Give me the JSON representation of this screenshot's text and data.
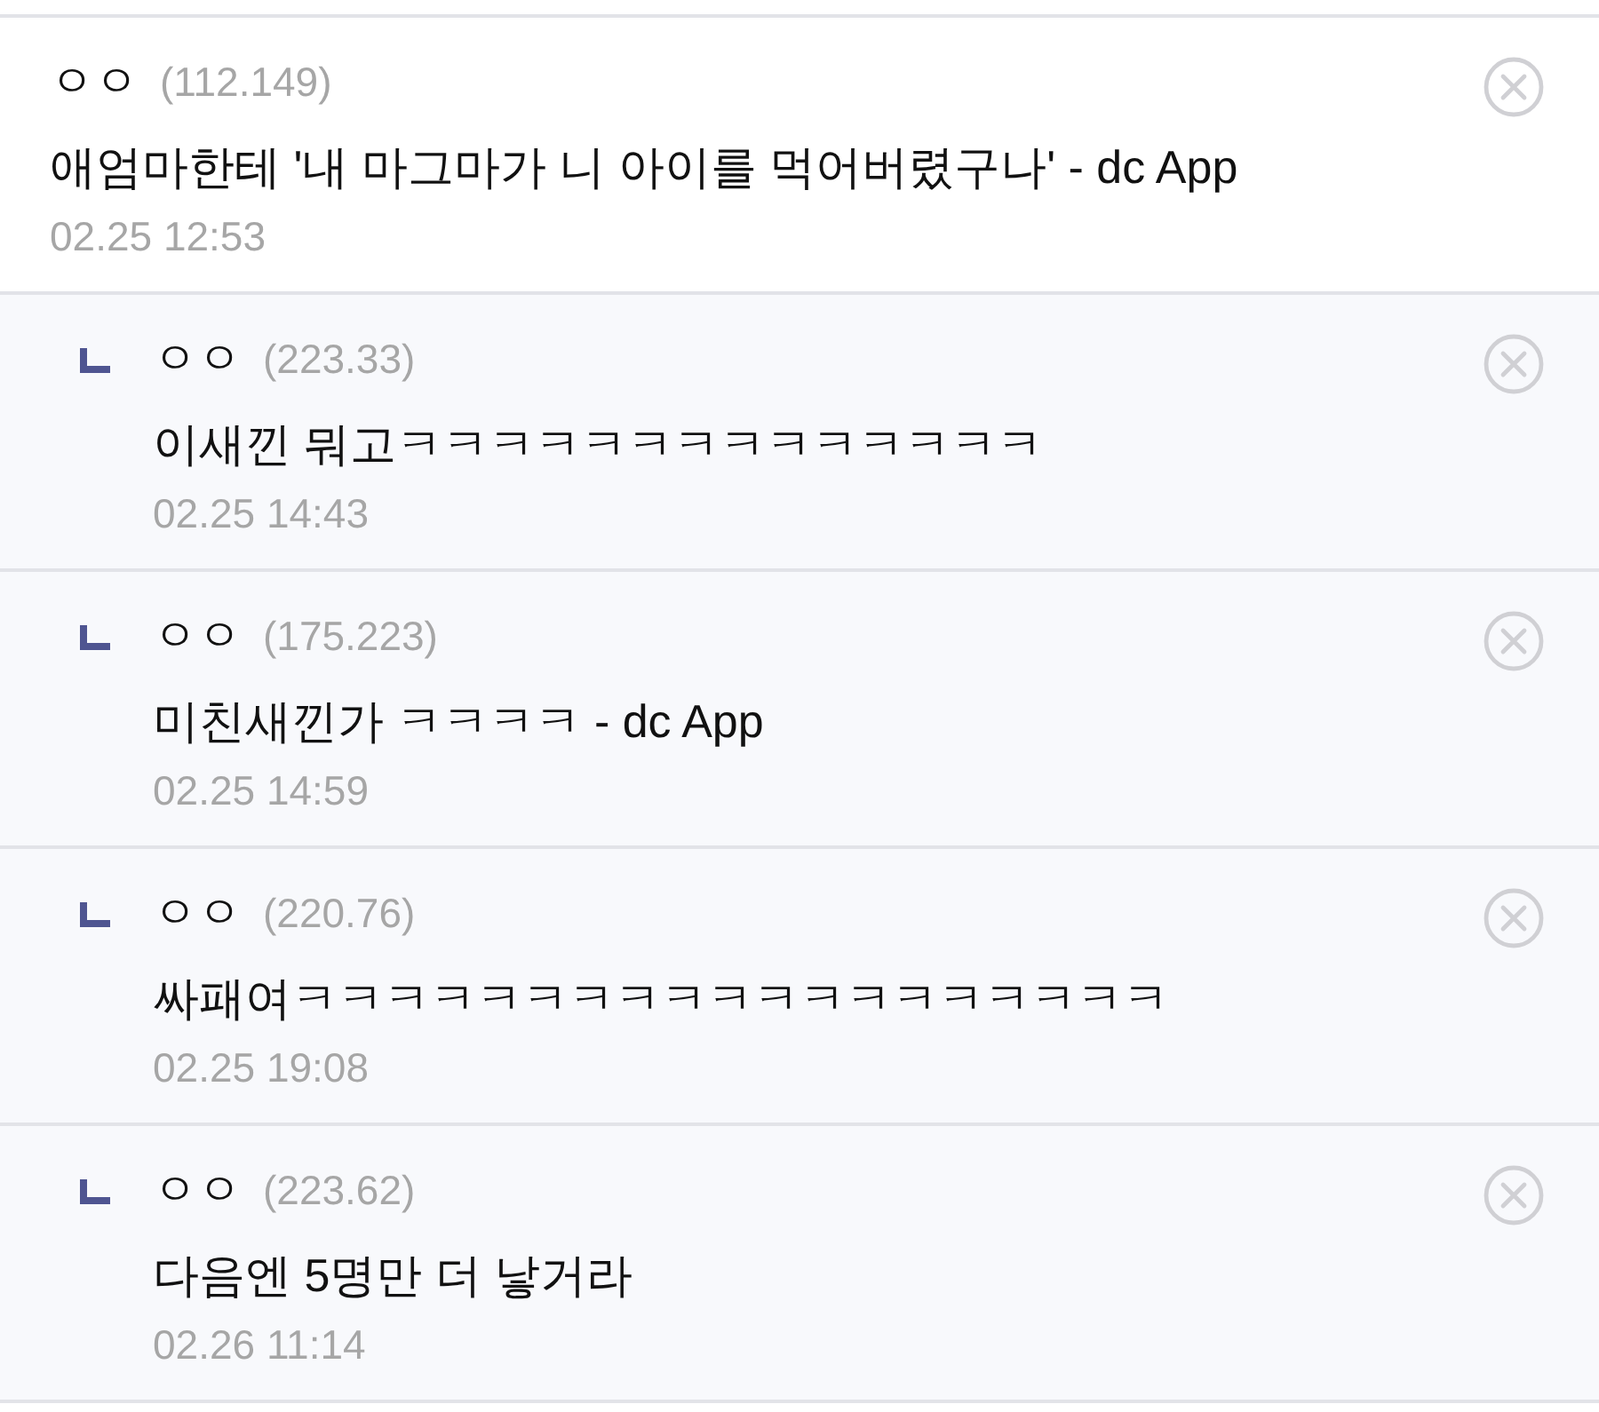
{
  "comments": [
    {
      "author": "ㅇㅇ",
      "ip": "(112.149)",
      "text": "애엄마한테 '내 마그마가 니 아이를 먹어버렸구나' - dc App",
      "date": "02.25 12:53",
      "children": [
        {
          "author": "ㅇㅇ",
          "ip": "(223.33)",
          "text": "이새낀 뭐고ㅋㅋㅋㅋㅋㅋㅋㅋㅋㅋㅋㅋㅋㅋ",
          "date": "02.25 14:43"
        },
        {
          "author": "ㅇㅇ",
          "ip": "(175.223)",
          "text": "미친새낀가 ㅋㅋㅋㅋ - dc App",
          "date": "02.25 14:59"
        },
        {
          "author": "ㅇㅇ",
          "ip": "(220.76)",
          "text": "싸패여ㅋㅋㅋㅋㅋㅋㅋㅋㅋㅋㅋㅋㅋㅋㅋㅋㅋㅋㅋ",
          "date": "02.25 19:08"
        },
        {
          "author": "ㅇㅇ",
          "ip": "(223.62)",
          "text": "다음엔 5명만 더 낳거라",
          "date": "02.26 11:14"
        }
      ]
    }
  ]
}
